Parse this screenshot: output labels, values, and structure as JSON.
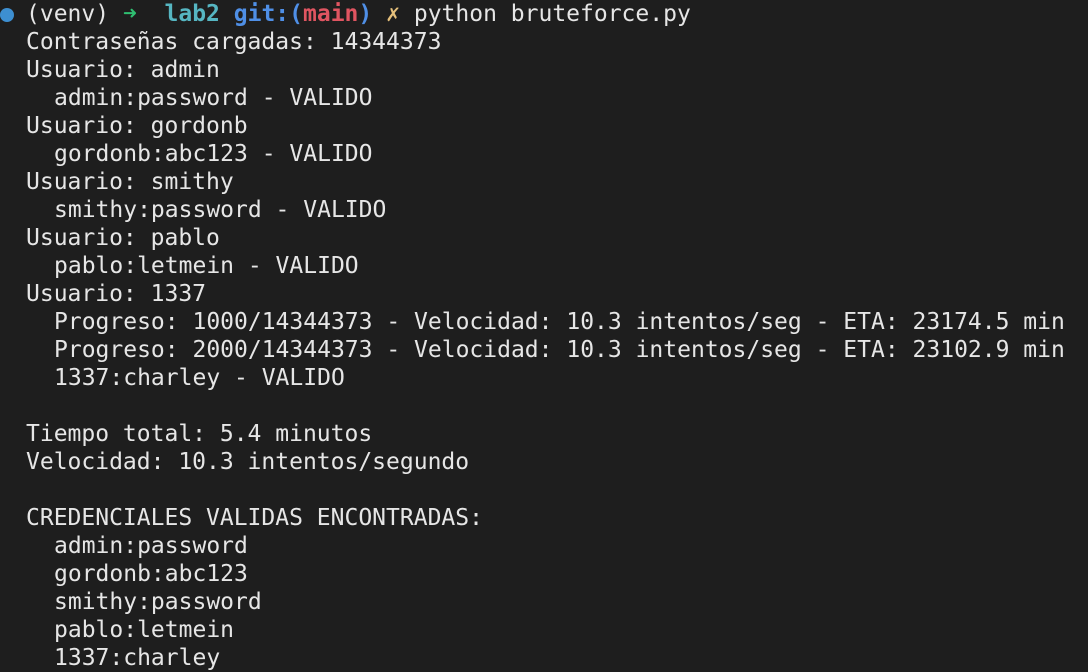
{
  "prompt": {
    "venv": "(venv)",
    "arrow": "➜",
    "dir": "lab2",
    "git_label": "git:(",
    "branch": "main",
    "git_close": ")",
    "dirty": "✗",
    "command": "python bruteforce.py",
    "dot_color": "#3d8fd1"
  },
  "output": {
    "loaded": "Contraseñas cargadas: 14344373",
    "user_admin": "Usuario: admin",
    "valid_admin": "admin:password - VALIDO",
    "user_gordonb": "Usuario: gordonb",
    "valid_gordonb": "gordonb:abc123 - VALIDO",
    "user_smithy": "Usuario: smithy",
    "valid_smithy": "smithy:password - VALIDO",
    "user_pablo": "Usuario: pablo",
    "valid_pablo": "pablo:letmein - VALIDO",
    "user_1337": "Usuario: 1337",
    "progress_1": "Progreso: 1000/14344373 - Velocidad: 10.3 intentos/seg - ETA: 23174.5 min",
    "progress_2": "Progreso: 2000/14344373 - Velocidad: 10.3 intentos/seg - ETA: 23102.9 min",
    "valid_1337": "1337:charley - VALIDO",
    "total_time": "Tiempo total: 5.4 minutos",
    "speed": "Velocidad: 10.3 intentos/segundo",
    "found_header": "CREDENCIALES VALIDAS ENCONTRADAS:",
    "found": [
      "admin:password",
      "gordonb:abc123",
      "smithy:password",
      "pablo:letmein",
      "1337:charley"
    ]
  }
}
